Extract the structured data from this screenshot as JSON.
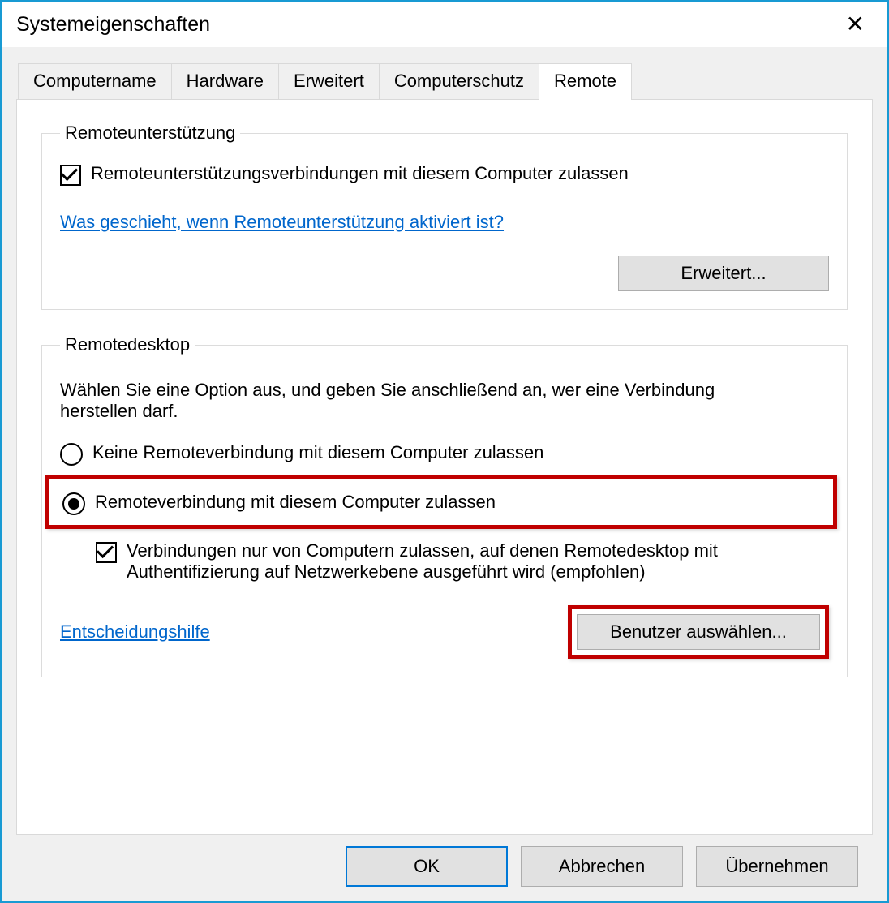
{
  "window": {
    "title": "Systemeigenschaften"
  },
  "tabs": {
    "items": [
      {
        "label": "Computername",
        "active": false
      },
      {
        "label": "Hardware",
        "active": false
      },
      {
        "label": "Erweitert",
        "active": false
      },
      {
        "label": "Computerschutz",
        "active": false
      },
      {
        "label": "Remote",
        "active": true
      }
    ]
  },
  "remoteSupport": {
    "legend": "Remoteunterstützung",
    "checkboxLabel": "Remoteunterstützungsverbindungen mit diesem Computer zulassen",
    "helpLink": "Was geschieht, wenn Remoteunterstützung aktiviert ist?",
    "advancedButton": "Erweitert..."
  },
  "remoteDesktop": {
    "legend": "Remotedesktop",
    "description": "Wählen Sie eine Option aus, und geben Sie anschließend an, wer eine Verbindung herstellen darf.",
    "radioNoConnection": "Keine Remoteverbindung mit diesem Computer zulassen",
    "radioAllowConnection": "Remoteverbindung mit diesem Computer zulassen",
    "subCheckboxLabel": "Verbindungen nur von Computern zulassen, auf denen Remotedesktop mit Authentifizierung auf Netzwerkebene ausgeführt wird (empfohlen)",
    "helpChoose": "Entscheidungshilfe",
    "selectUsersButton": "Benutzer auswählen..."
  },
  "footer": {
    "ok": "OK",
    "cancel": "Abbrechen",
    "apply": "Übernehmen"
  }
}
